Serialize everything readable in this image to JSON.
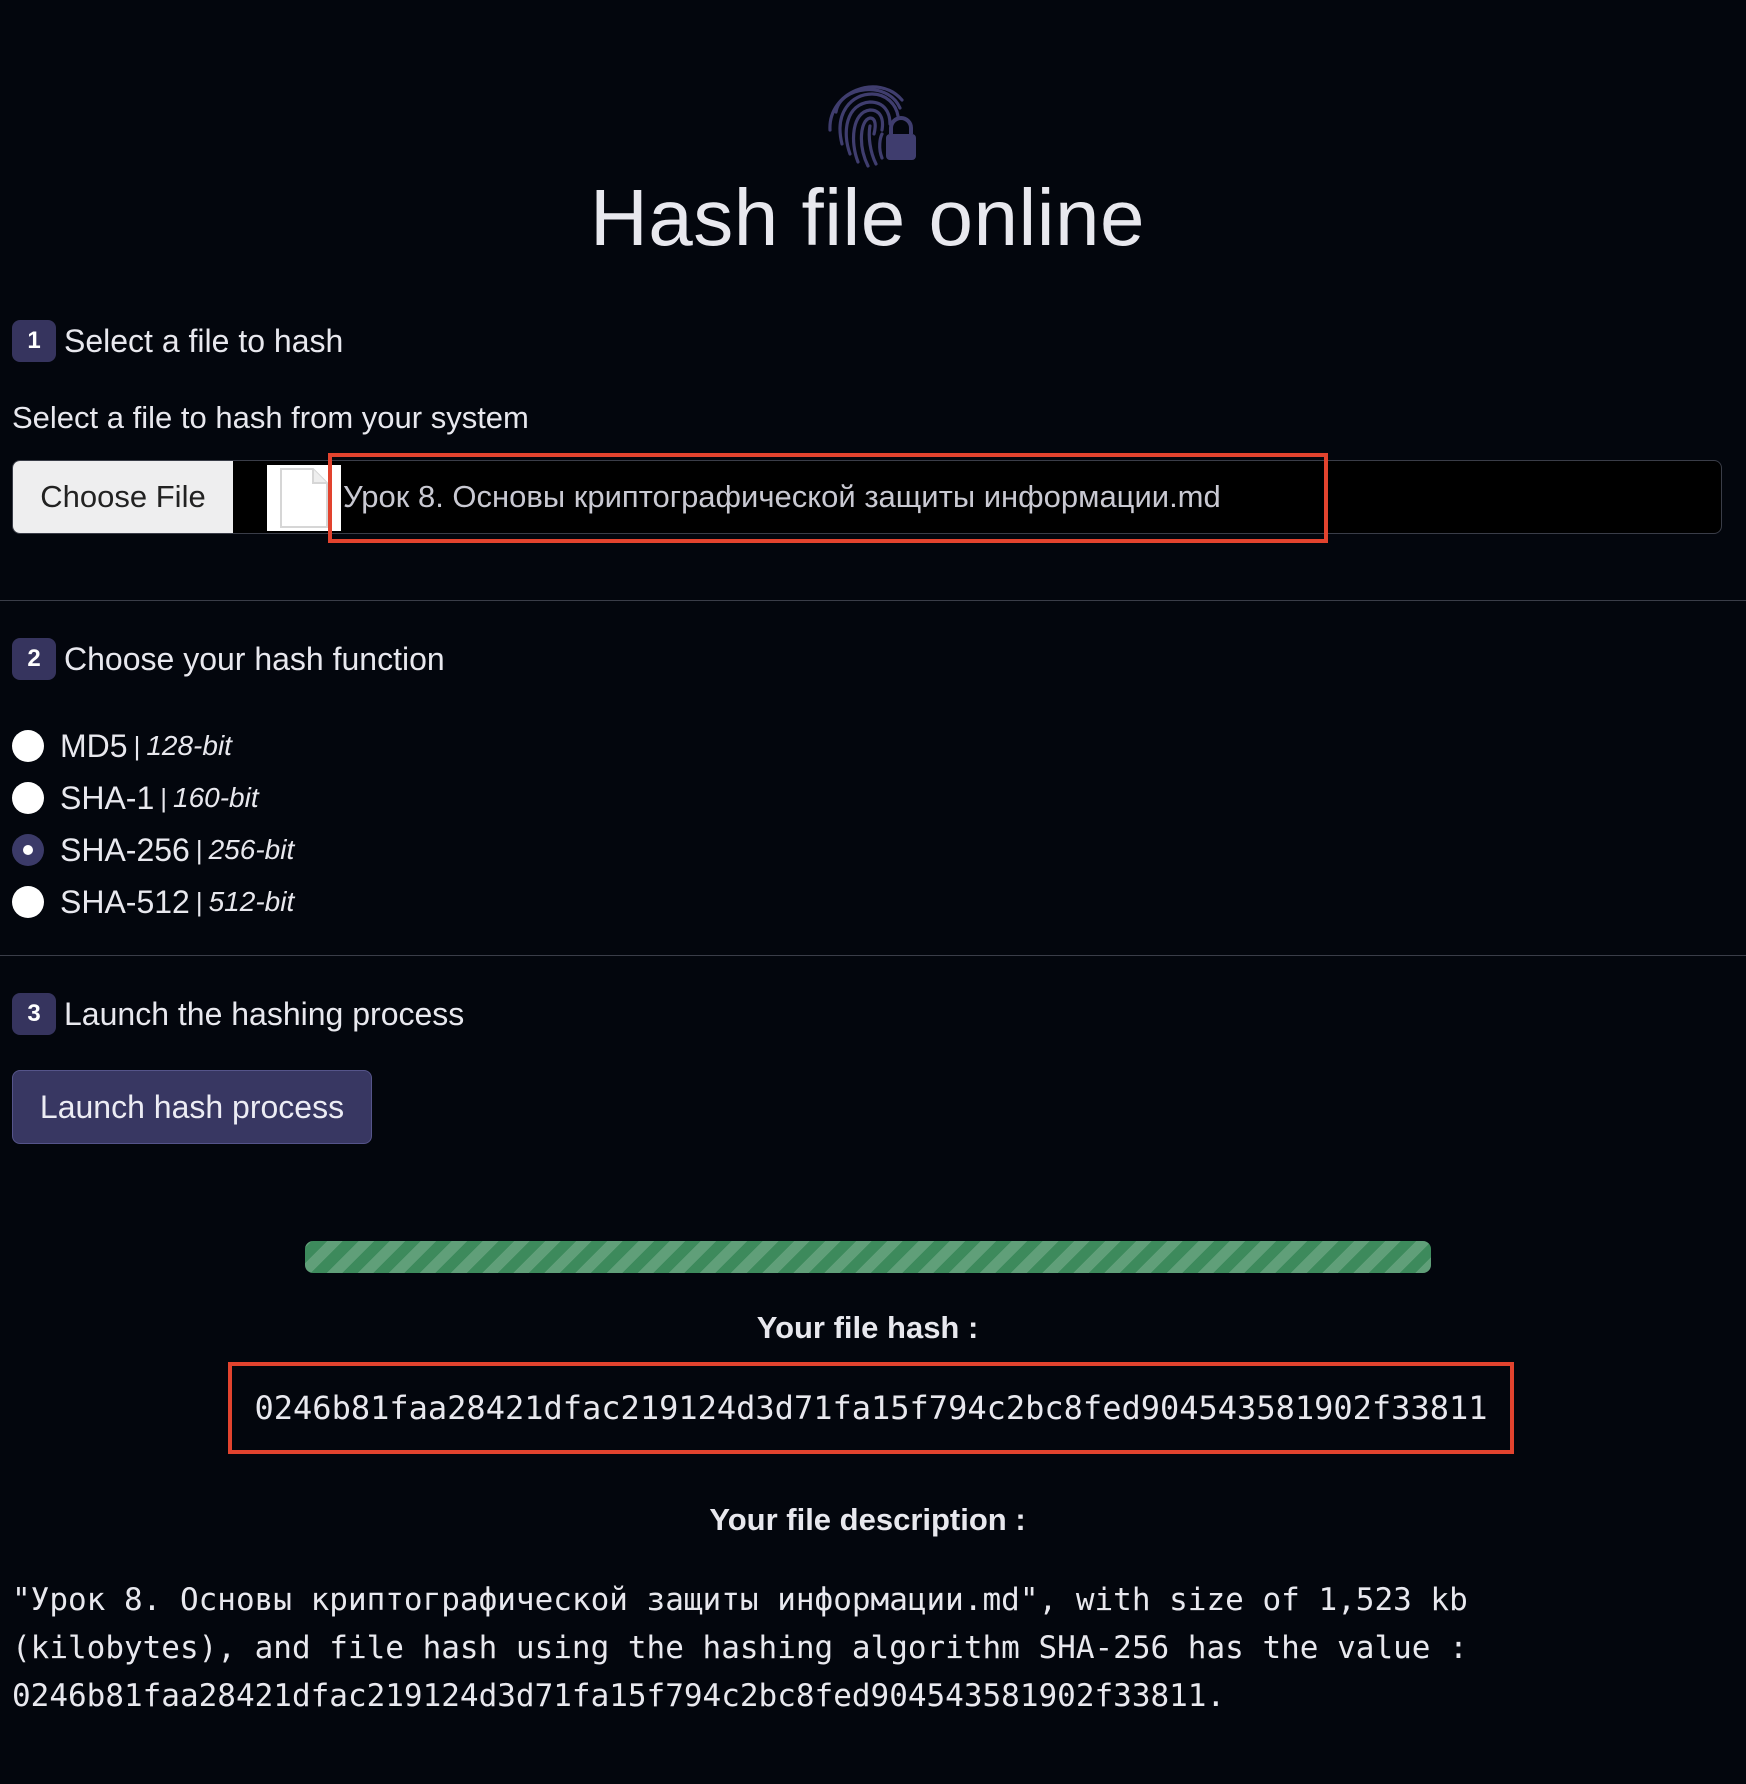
{
  "header": {
    "title": "Hash file online",
    "logo_icon": "fingerprint-lock-icon"
  },
  "step1": {
    "number": "1",
    "title": "Select a file to hash",
    "subtitle": "Select a file to hash from your system",
    "choose_button": "Choose File",
    "file_name": "Урок 8. Основы криптографической защиты информации.md"
  },
  "step2": {
    "number": "2",
    "title": "Choose your hash function",
    "options": [
      {
        "name": "MD5",
        "sep": "|",
        "bits": "128-bit",
        "checked": false
      },
      {
        "name": "SHA-1",
        "sep": "|",
        "bits": "160-bit",
        "checked": false
      },
      {
        "name": "SHA-256",
        "sep": "|",
        "bits": "256-bit",
        "checked": true
      },
      {
        "name": "SHA-512",
        "sep": "|",
        "bits": "512-bit",
        "checked": false
      }
    ]
  },
  "step3": {
    "number": "3",
    "title": "Launch the hashing process",
    "launch_button": "Launch hash process"
  },
  "progress": {
    "percent": 100,
    "color": "#3d8a5c"
  },
  "result": {
    "hash_label": "Your file hash :",
    "hash_value": "0246b81faa28421dfac219124d3d71fa15f794c2bc8fed904543581902f33811",
    "description_label": "Your file description :",
    "description_text": "\"Урок 8. Основы криптографической защиты информации.md\", with size of 1,523 kb (kilobytes), and file hash using the hashing algorithm SHA-256 has the value : 0246b81faa28421dfac219124d3d71fa15f794c2bc8fed904543581902f33811."
  },
  "colors": {
    "background": "#03060d",
    "accent": "#36345e",
    "highlight": "#e2432e"
  }
}
